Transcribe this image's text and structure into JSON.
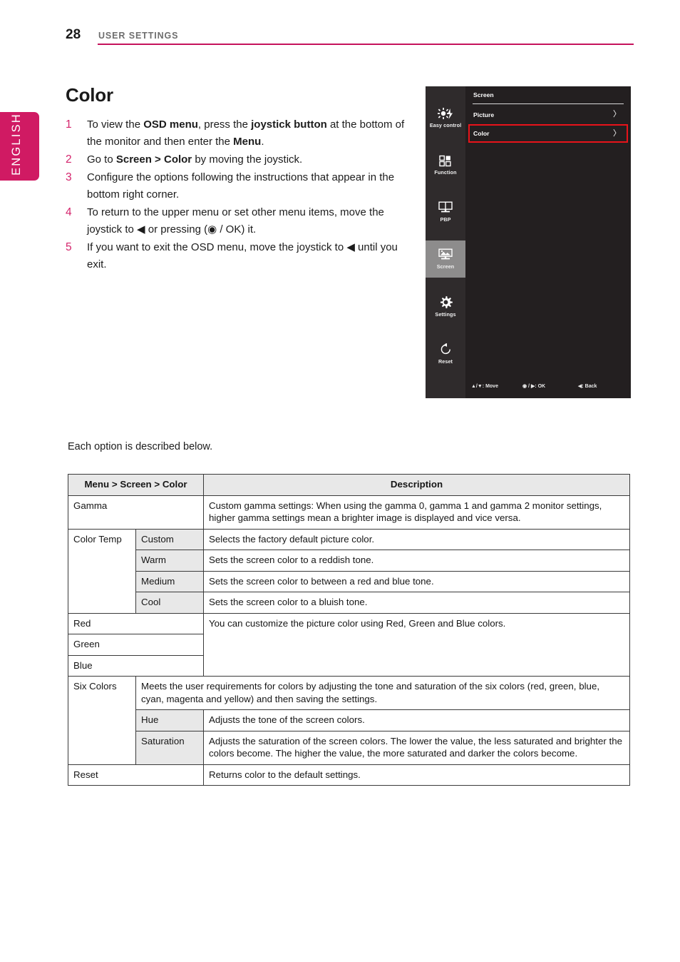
{
  "header": {
    "page_number": "28",
    "title": "USER SETTINGS",
    "rule_color": "#c5125c"
  },
  "language_tab": {
    "label": "ENGLISH",
    "color": "#d01a63"
  },
  "section": {
    "title": "Color",
    "note": "Each option is described below."
  },
  "steps": [
    {
      "number": "1",
      "parts": [
        {
          "t": "To view the ",
          "b": false
        },
        {
          "t": "OSD menu",
          "b": true
        },
        {
          "t": ", press the ",
          "b": false
        },
        {
          "t": "joystick button",
          "b": true
        },
        {
          "t": " at the bottom of the monitor and then enter the ",
          "b": false
        },
        {
          "t": "Menu",
          "b": true
        },
        {
          "t": ".",
          "b": false
        }
      ]
    },
    {
      "number": "2",
      "parts": [
        {
          "t": "Go to ",
          "b": false
        },
        {
          "t": "Screen > Color",
          "b": true
        },
        {
          "t": " by moving the joystick.",
          "b": false
        }
      ]
    },
    {
      "number": "3",
      "parts": [
        {
          "t": "Configure the options following the instructions that appear in the bottom right corner.",
          "b": false
        }
      ]
    },
    {
      "number": "4",
      "parts": [
        {
          "t": "To return to the upper menu or set other menu items, move the joystick to ◀ or pressing (◉ / OK) it.",
          "b": false
        }
      ]
    },
    {
      "number": "5",
      "parts": [
        {
          "t": "If you want to exit the OSD menu, move the joystick to ◀ until you exit.",
          "b": false
        }
      ]
    }
  ],
  "osd": {
    "title": "Screen",
    "sidebar": [
      {
        "label": "Easy control",
        "icon": "brightness-bolt-icon",
        "active": false
      },
      {
        "label": "Function",
        "icon": "function-grid-icon",
        "active": false
      },
      {
        "label": "PBP",
        "icon": "pbp-monitor-icon",
        "active": false
      },
      {
        "label": "Screen",
        "icon": "screen-picture-icon",
        "active": true
      },
      {
        "label": "Settings",
        "icon": "gear-icon",
        "active": false
      },
      {
        "label": "Reset",
        "icon": "reset-arrow-icon",
        "active": false
      }
    ],
    "rows": [
      {
        "label": "Picture",
        "arrow": "〉",
        "highlighted": false
      },
      {
        "label": "Color",
        "arrow": "〉",
        "highlighted": true
      }
    ],
    "highlight_color": "#e8131a",
    "footer": {
      "move": "▲/▼: Move",
      "ok": "◉ / ▶: OK",
      "back": "◀: Back"
    }
  },
  "table": {
    "headers": {
      "menu": "Menu > Screen > Color",
      "description": "Description"
    },
    "rows": [
      {
        "kind": "simple",
        "label": "Gamma",
        "description": "Custom gamma settings: When using the gamma 0, gamma 1 and gamma 2 monitor settings, higher gamma settings mean a brighter image is displayed and vice versa."
      },
      {
        "kind": "grouped",
        "label": "Color Temp",
        "subrows": [
          {
            "sub": "Custom",
            "description": "Selects the factory default picture color."
          },
          {
            "sub": "Warm",
            "description": "Sets the screen color to a reddish tone."
          },
          {
            "sub": "Medium",
            "description": "Sets the screen color to between a red and blue tone."
          },
          {
            "sub": "Cool",
            "description": "Sets the screen color to a bluish tone."
          }
        ]
      },
      {
        "kind": "multilabel",
        "labels": [
          "Red",
          "Green",
          "Blue"
        ],
        "description": "You can customize the picture color using Red, Green and Blue colors."
      },
      {
        "kind": "grouped-intro",
        "label": "Six Colors",
        "intro": "Meets the user requirements for colors by adjusting the tone and saturation of the six colors (red, green, blue, cyan, magenta and yellow) and then saving the settings.",
        "subrows": [
          {
            "sub": "Hue",
            "description": "Adjusts the tone of the screen colors."
          },
          {
            "sub": "Saturation",
            "description": "Adjusts the saturation of the screen colors. The lower the value, the less saturated and brighter the colors become. The higher the value, the more saturated and darker the colors become."
          }
        ]
      },
      {
        "kind": "simple",
        "label": "Reset",
        "description": "Returns color to the default settings."
      }
    ]
  }
}
